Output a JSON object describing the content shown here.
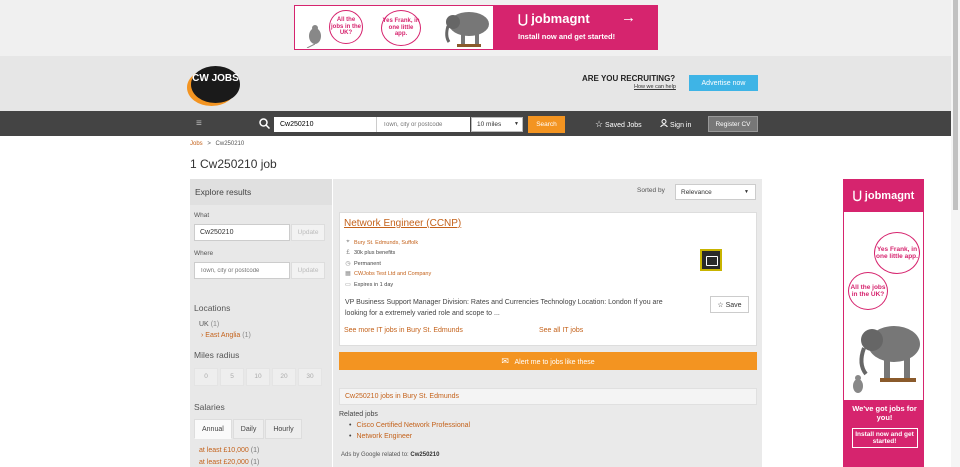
{
  "top_banner": {
    "bubble_1": "All the jobs in the UK?",
    "bubble_2": "Yes Frank, in one little app.",
    "brand": "jobmagnt",
    "tagline": "Install now and get started!",
    "arrow": "→"
  },
  "header": {
    "logo": "CW JOBS",
    "recruiting": "ARE YOU RECRUITING?",
    "recruit_link": "How we can help",
    "advertise_button": "Advertise now"
  },
  "searchbar": {
    "hamburger": "≡",
    "keyword_value": "Cw250210",
    "location_placeholder": "Town, city or postcode",
    "radius": "10 miles",
    "search_button": "Search",
    "saved_jobs": "Saved Jobs",
    "sign_in": "Sign in",
    "register_button": "Register CV"
  },
  "breadcrumb": {
    "jobs": "Jobs",
    "sep": ">",
    "current": "Cw250210"
  },
  "page_title": "1 Cw250210 job",
  "sidebar": {
    "heading": "Explore results",
    "what_label": "What",
    "what_value": "Cw250210",
    "where_label": "Where",
    "where_placeholder": "Town, city or postcode",
    "update": "Update",
    "locations_heading": "Locations",
    "loc_uk": "UK",
    "loc_uk_count": "(1)",
    "loc_east": "East Anglia",
    "loc_east_count": "(1)",
    "miles_heading": "Miles radius",
    "miles": [
      "0",
      "5",
      "10",
      "20",
      "30"
    ],
    "salaries_heading": "Salaries",
    "salary_tabs": [
      "Annual",
      "Daily",
      "Hourly"
    ],
    "salary_1": "at least £10,000",
    "salary_1_count": "(1)",
    "salary_2": "at least £20,000",
    "salary_2_count": "(1)"
  },
  "sort": {
    "label": "Sorted by",
    "value": "Relevance"
  },
  "job": {
    "title": "Network Engineer (CCNP)",
    "location": "Bury St. Edmunds, Suffolk",
    "salary": "30k plus benefits",
    "type": "Permanent",
    "company": "CWJobs Test Ltd and Company",
    "expires": "Expires in 1 day",
    "description": "VP Business Support Manager Division: Rates and Currencies Technology Location: London If you are looking for a extremely varied role and scope to ...",
    "save": "Save",
    "more_link": "See more IT jobs in Bury St. Edmunds",
    "all_link": "See all IT jobs"
  },
  "alert_button": "Alert me to jobs like these",
  "bury_link": "Cw250210 jobs in Bury St. Edmunds",
  "related": {
    "label": "Related jobs",
    "items": [
      "Cisco Certified Network Professional",
      "Network Engineer"
    ]
  },
  "ads": {
    "prefix": "Ads by Google related to:",
    "term": "Cw250210"
  },
  "side_ad": {
    "brand": "jobmagnt",
    "bubble_1": "Yes Frank, in one little app.",
    "bubble_2": "All the jobs in the UK?",
    "headline": "We've got jobs for you!",
    "cta": "Install now and get started!"
  },
  "colors": {
    "accent": "#f39421",
    "brand_pink": "#d6246e",
    "link": "#c4621b",
    "nav": "#444444"
  }
}
